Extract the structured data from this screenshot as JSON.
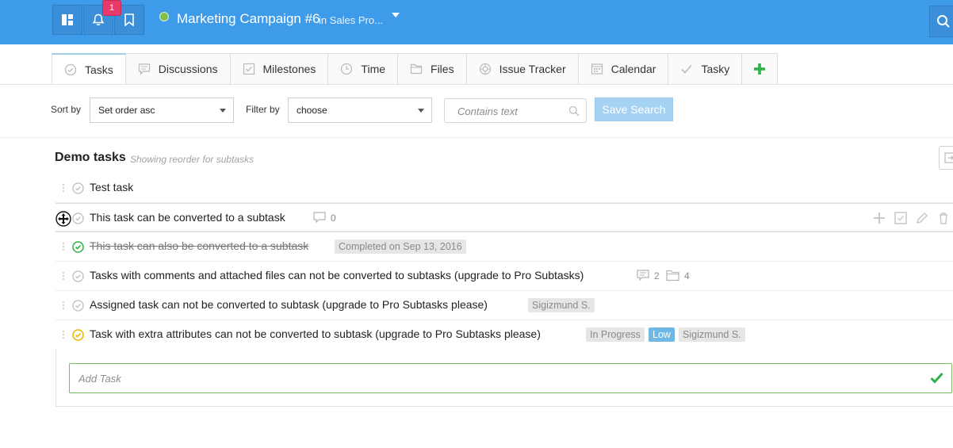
{
  "header": {
    "notifications_count": "1",
    "project_title": "Marketing Campaign #6",
    "project_context": "in Sales Pro...",
    "project_status_color": "#7fbf4d",
    "icons": [
      "dashboard-icon",
      "bell-icon",
      "bookmark-icon",
      "search-icon"
    ]
  },
  "tabs": [
    {
      "label": "Tasks",
      "icon": "check-circle-icon",
      "active": true
    },
    {
      "label": "Discussions",
      "icon": "comment-icon"
    },
    {
      "label": "Milestones",
      "icon": "checkbox-icon"
    },
    {
      "label": "Time",
      "icon": "clock-icon"
    },
    {
      "label": "Files",
      "icon": "folder-icon"
    },
    {
      "label": "Issue Tracker",
      "icon": "lifebuoy-icon"
    },
    {
      "label": "Calendar",
      "icon": "calendar-icon"
    },
    {
      "label": "Tasky",
      "icon": "checkmark-icon"
    },
    {
      "label": "",
      "icon": "plus-icon",
      "color": "#2fb14a"
    }
  ],
  "filters": {
    "sort_label": "Sort by",
    "sort_value": "Set order asc",
    "filter_label": "Filter by",
    "filter_value": "choose",
    "text_placeholder": "Contains text",
    "save_search_label": "Save Search"
  },
  "list": {
    "title": "Demo tasks",
    "subtitle": "Showing reorder for subtasks",
    "tasks": [
      {
        "name": "Test task",
        "status": "open"
      },
      {
        "name": "This task can be converted to a subtask",
        "status": "open",
        "comments": "0",
        "hovered": true
      },
      {
        "name": "This task can also be converted to a subtask",
        "status": "completed",
        "completed_label": "Completed on Sep 13, 2016"
      },
      {
        "name": "Tasks with comments and attached files can not be converted to subtasks (upgrade to Pro Subtasks)",
        "status": "open",
        "comments": "2",
        "files": "4"
      },
      {
        "name": "Assigned task can not be converted to subtask (upgrade to Pro Subtasks please)",
        "status": "open",
        "assignee": "Sigizmund S."
      },
      {
        "name": "Task with extra attributes can not be converted to subtask (upgrade to Pro Subtasks please)",
        "status": "in-progress",
        "progress_label": "In Progress",
        "priority": "Low",
        "assignee": "Sigizmund S."
      }
    ]
  },
  "add_task": {
    "placeholder": "Add Task"
  },
  "colors": {
    "header_bg": "#3d9be9",
    "completed_check": "#2fb14a",
    "in_progress_check": "#e8b500",
    "low_badge": "#6fb8e4",
    "add_task_border": "#7ab861"
  }
}
